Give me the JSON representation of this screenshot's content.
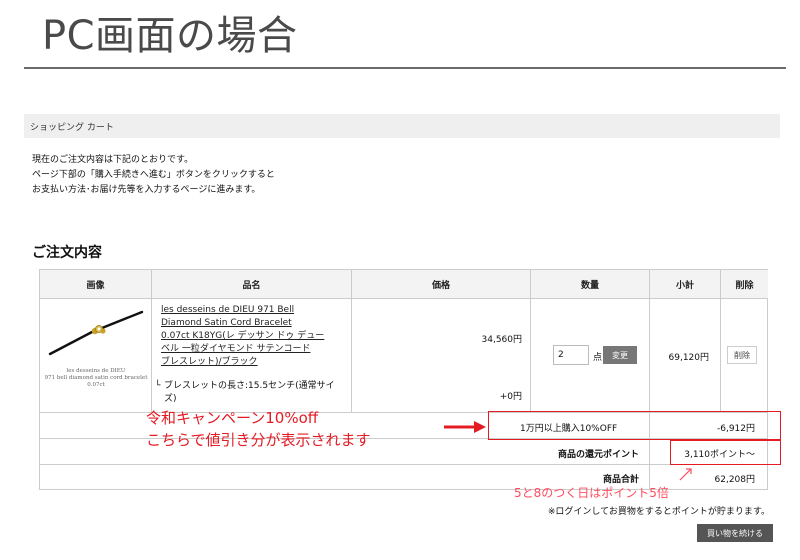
{
  "slide": {
    "title": "PC画面の場合"
  },
  "page": {
    "header": "ショッピング カート"
  },
  "intro": [
    "現在のご注文内容は下記のとおりです。",
    "ページ下部の「購入手続きへ進む」ボタンをクリックすると",
    "お支払い方法･お届け先等を入力するページに進みます。"
  ],
  "order": {
    "section_title": "ご注文内容",
    "columns": {
      "image": "画像",
      "name": "品名",
      "price": "価格",
      "qty": "数量",
      "subtotal": "小計",
      "delete": "削除"
    },
    "product": {
      "image_caption": [
        "les desseins de DIEU",
        "971 bell diamond satin cord bracelet",
        "0.07ct"
      ],
      "name_lines": [
        "les desseins de DIEU 971 Bell",
        "Diamond Satin Cord Bracelet",
        "0.07ct K18YG(レ デッサン ドゥ デュー",
        "ベル 一粒ダイヤモンド サテンコード",
        "ブレスレット)/ブラック"
      ],
      "option_mark": "└",
      "option_lines": [
        "ブレスレットの長さ:15.5センチ(通常サイ",
        "ズ)"
      ],
      "price": "34,560円",
      "option_price": "+0円",
      "qty": "2",
      "qty_unit": "点",
      "change_label": "変更",
      "subtotal": "69,120円",
      "delete_label": "削除"
    },
    "discount": {
      "label": "1万円以上購入10%OFF",
      "value": "-6,912円"
    },
    "points": {
      "label": "商品の還元ポイント",
      "value": "3,110ポイント～"
    },
    "total": {
      "label": "商品合計",
      "value": "62,208円"
    },
    "login_note": "※ログインしてお買物をするとポイントが貯まります。",
    "continue_label": "買い物を続ける"
  },
  "annotations": {
    "campaign_line1": "令和キャンペーン10%off",
    "campaign_line2": "こちらで値引き分が表示されます",
    "points_note": "5と8のつく日はポイント5倍",
    "accent_color": "#e51b24",
    "note_color": "#ff4d5e"
  }
}
